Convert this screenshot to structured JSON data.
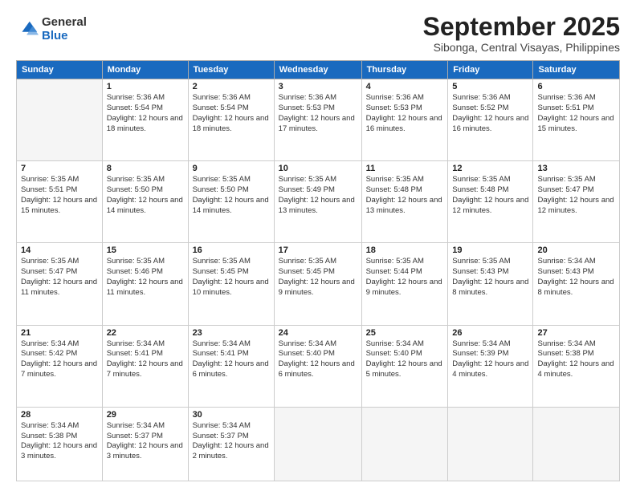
{
  "logo": {
    "general": "General",
    "blue": "Blue"
  },
  "title": "September 2025",
  "location": "Sibonga, Central Visayas, Philippines",
  "days": [
    "Sunday",
    "Monday",
    "Tuesday",
    "Wednesday",
    "Thursday",
    "Friday",
    "Saturday"
  ],
  "weeks": [
    [
      {
        "num": "",
        "empty": true
      },
      {
        "num": "1",
        "sunrise": "5:36 AM",
        "sunset": "5:54 PM",
        "daylight": "12 hours and 18 minutes."
      },
      {
        "num": "2",
        "sunrise": "5:36 AM",
        "sunset": "5:54 PM",
        "daylight": "12 hours and 18 minutes."
      },
      {
        "num": "3",
        "sunrise": "5:36 AM",
        "sunset": "5:53 PM",
        "daylight": "12 hours and 17 minutes."
      },
      {
        "num": "4",
        "sunrise": "5:36 AM",
        "sunset": "5:53 PM",
        "daylight": "12 hours and 16 minutes."
      },
      {
        "num": "5",
        "sunrise": "5:36 AM",
        "sunset": "5:52 PM",
        "daylight": "12 hours and 16 minutes."
      },
      {
        "num": "6",
        "sunrise": "5:36 AM",
        "sunset": "5:51 PM",
        "daylight": "12 hours and 15 minutes."
      }
    ],
    [
      {
        "num": "7",
        "sunrise": "5:35 AM",
        "sunset": "5:51 PM",
        "daylight": "12 hours and 15 minutes."
      },
      {
        "num": "8",
        "sunrise": "5:35 AM",
        "sunset": "5:50 PM",
        "daylight": "12 hours and 14 minutes."
      },
      {
        "num": "9",
        "sunrise": "5:35 AM",
        "sunset": "5:50 PM",
        "daylight": "12 hours and 14 minutes."
      },
      {
        "num": "10",
        "sunrise": "5:35 AM",
        "sunset": "5:49 PM",
        "daylight": "12 hours and 13 minutes."
      },
      {
        "num": "11",
        "sunrise": "5:35 AM",
        "sunset": "5:48 PM",
        "daylight": "12 hours and 13 minutes."
      },
      {
        "num": "12",
        "sunrise": "5:35 AM",
        "sunset": "5:48 PM",
        "daylight": "12 hours and 12 minutes."
      },
      {
        "num": "13",
        "sunrise": "5:35 AM",
        "sunset": "5:47 PM",
        "daylight": "12 hours and 12 minutes."
      }
    ],
    [
      {
        "num": "14",
        "sunrise": "5:35 AM",
        "sunset": "5:47 PM",
        "daylight": "12 hours and 11 minutes."
      },
      {
        "num": "15",
        "sunrise": "5:35 AM",
        "sunset": "5:46 PM",
        "daylight": "12 hours and 11 minutes."
      },
      {
        "num": "16",
        "sunrise": "5:35 AM",
        "sunset": "5:45 PM",
        "daylight": "12 hours and 10 minutes."
      },
      {
        "num": "17",
        "sunrise": "5:35 AM",
        "sunset": "5:45 PM",
        "daylight": "12 hours and 9 minutes."
      },
      {
        "num": "18",
        "sunrise": "5:35 AM",
        "sunset": "5:44 PM",
        "daylight": "12 hours and 9 minutes."
      },
      {
        "num": "19",
        "sunrise": "5:35 AM",
        "sunset": "5:43 PM",
        "daylight": "12 hours and 8 minutes."
      },
      {
        "num": "20",
        "sunrise": "5:34 AM",
        "sunset": "5:43 PM",
        "daylight": "12 hours and 8 minutes."
      }
    ],
    [
      {
        "num": "21",
        "sunrise": "5:34 AM",
        "sunset": "5:42 PM",
        "daylight": "12 hours and 7 minutes."
      },
      {
        "num": "22",
        "sunrise": "5:34 AM",
        "sunset": "5:41 PM",
        "daylight": "12 hours and 7 minutes."
      },
      {
        "num": "23",
        "sunrise": "5:34 AM",
        "sunset": "5:41 PM",
        "daylight": "12 hours and 6 minutes."
      },
      {
        "num": "24",
        "sunrise": "5:34 AM",
        "sunset": "5:40 PM",
        "daylight": "12 hours and 6 minutes."
      },
      {
        "num": "25",
        "sunrise": "5:34 AM",
        "sunset": "5:40 PM",
        "daylight": "12 hours and 5 minutes."
      },
      {
        "num": "26",
        "sunrise": "5:34 AM",
        "sunset": "5:39 PM",
        "daylight": "12 hours and 4 minutes."
      },
      {
        "num": "27",
        "sunrise": "5:34 AM",
        "sunset": "5:38 PM",
        "daylight": "12 hours and 4 minutes."
      }
    ],
    [
      {
        "num": "28",
        "sunrise": "5:34 AM",
        "sunset": "5:38 PM",
        "daylight": "12 hours and 3 minutes."
      },
      {
        "num": "29",
        "sunrise": "5:34 AM",
        "sunset": "5:37 PM",
        "daylight": "12 hours and 3 minutes."
      },
      {
        "num": "30",
        "sunrise": "5:34 AM",
        "sunset": "5:37 PM",
        "daylight": "12 hours and 2 minutes."
      },
      {
        "num": "",
        "empty": true
      },
      {
        "num": "",
        "empty": true
      },
      {
        "num": "",
        "empty": true
      },
      {
        "num": "",
        "empty": true
      }
    ]
  ]
}
